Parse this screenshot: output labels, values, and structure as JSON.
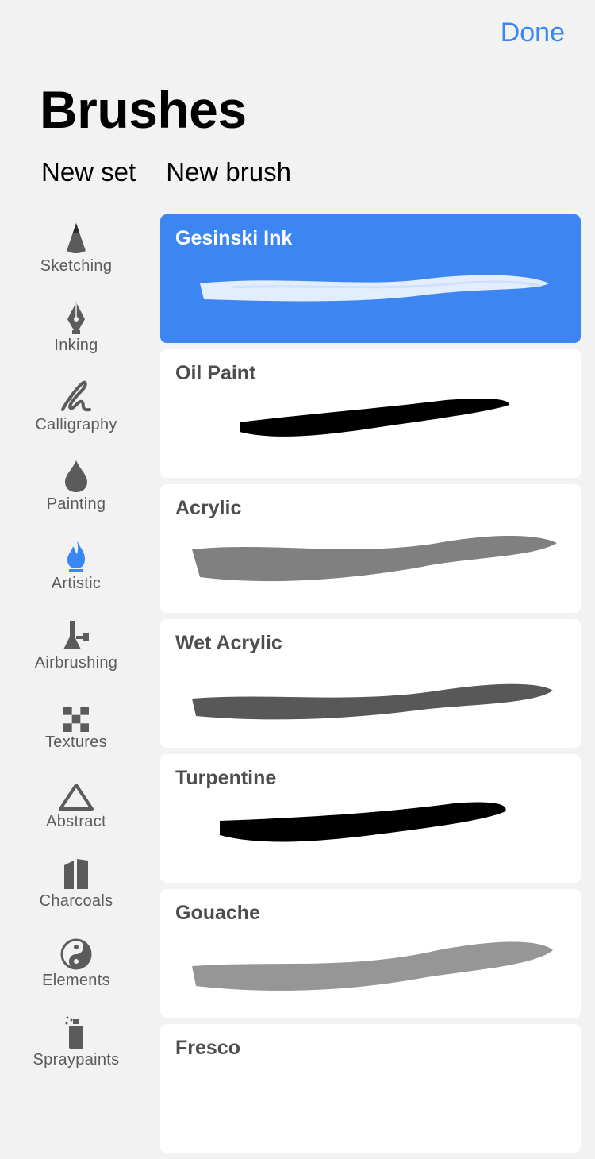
{
  "header": {
    "done_label": "Done",
    "title": "Brushes",
    "new_set_label": "New set",
    "new_brush_label": "New brush"
  },
  "sidebar": {
    "active_index": 4,
    "items": [
      {
        "label": "Sketching",
        "icon": "pencil-tip-icon"
      },
      {
        "label": "Inking",
        "icon": "pen-nib-icon"
      },
      {
        "label": "Calligraphy",
        "icon": "calligraphy-stroke-icon"
      },
      {
        "label": "Painting",
        "icon": "paint-drop-icon"
      },
      {
        "label": "Artistic",
        "icon": "flame-icon"
      },
      {
        "label": "Airbrushing",
        "icon": "airbrush-icon"
      },
      {
        "label": "Textures",
        "icon": "checkerboard-icon"
      },
      {
        "label": "Abstract",
        "icon": "triangle-icon"
      },
      {
        "label": "Charcoals",
        "icon": "charcoal-sticks-icon"
      },
      {
        "label": "Elements",
        "icon": "yin-yang-icon"
      },
      {
        "label": "Spraypaints",
        "icon": "spray-can-icon"
      }
    ]
  },
  "brushes": {
    "selected_index": 0,
    "items": [
      {
        "name": "Gesinski Ink"
      },
      {
        "name": "Oil Paint"
      },
      {
        "name": "Acrylic"
      },
      {
        "name": "Wet Acrylic"
      },
      {
        "name": "Turpentine"
      },
      {
        "name": "Gouache"
      },
      {
        "name": "Fresco"
      }
    ]
  },
  "colors": {
    "accent": "#3a86f2",
    "selected_card": "#3d86f2",
    "background": "#f2f2f2"
  }
}
